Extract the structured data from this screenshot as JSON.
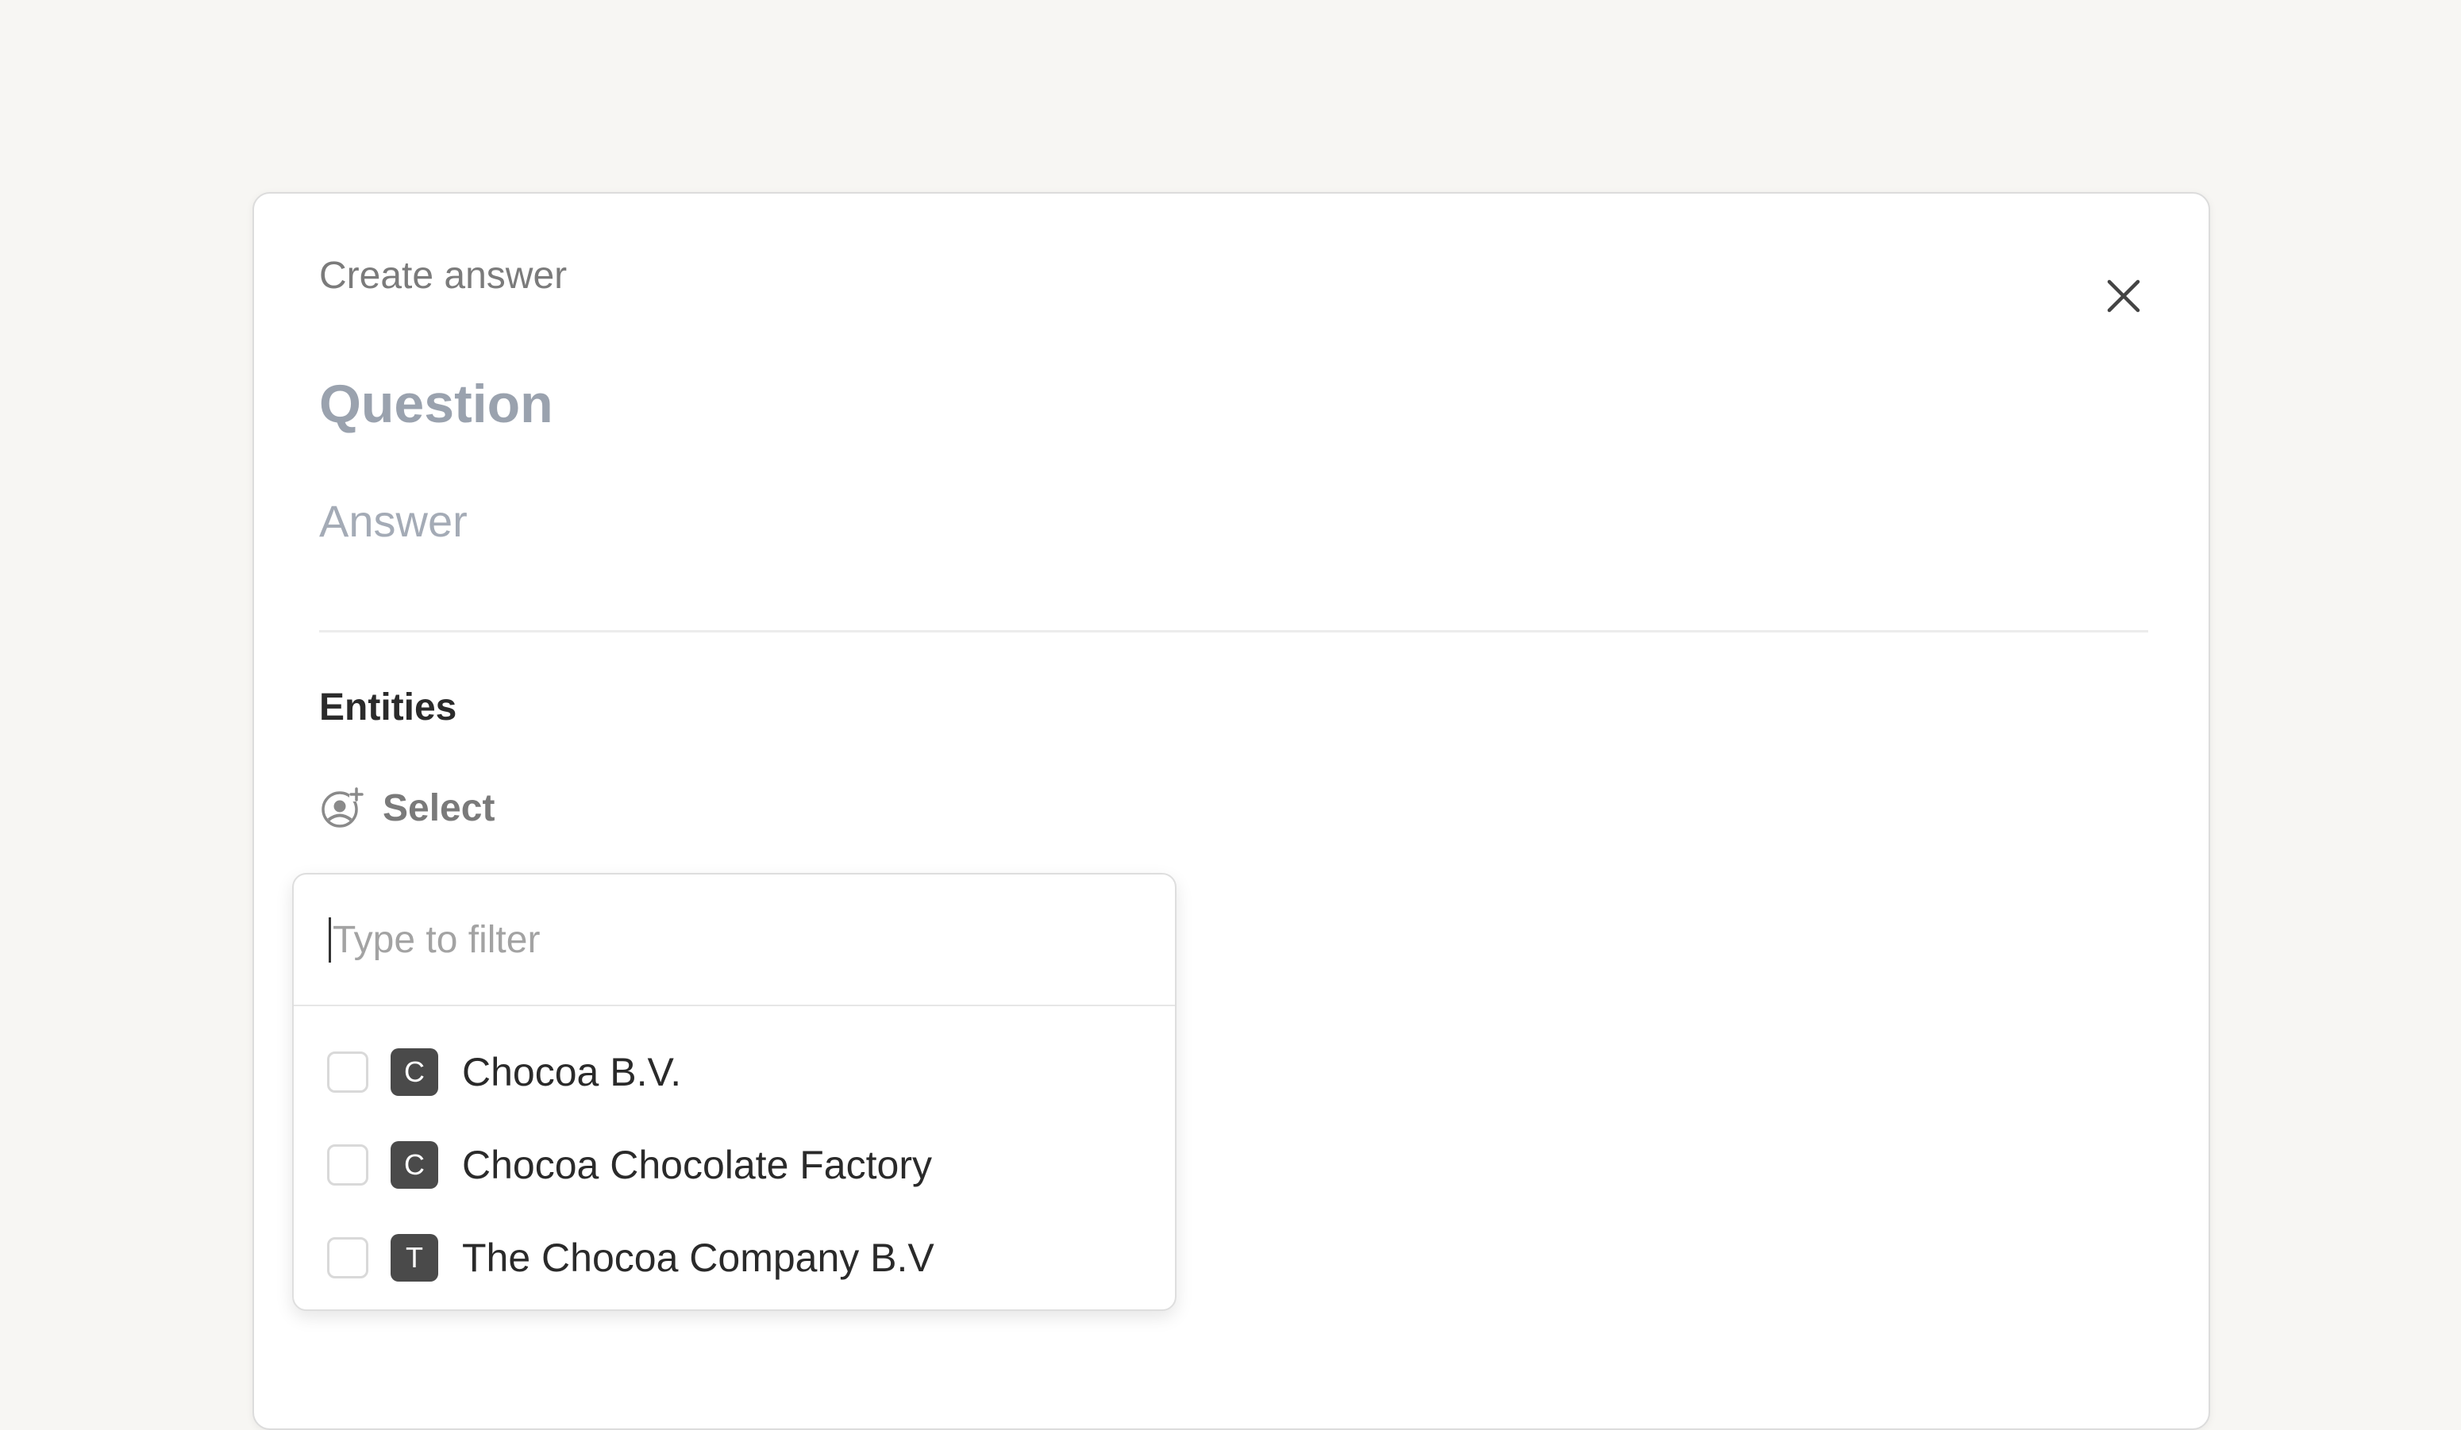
{
  "modal": {
    "title": "Create answer",
    "question_placeholder": "Question",
    "answer_placeholder": "Answer",
    "entities_label": "Entities",
    "select_label": "Select",
    "close_icon": "close-icon",
    "select_icon": "user-add-icon"
  },
  "dropdown": {
    "filter_placeholder": "Type to filter",
    "filter_value": "",
    "options": [
      {
        "initial": "C",
        "label": "Chocoa B.V."
      },
      {
        "initial": "C",
        "label": "Chocoa Chocolate Factory"
      },
      {
        "initial": "T",
        "label": "The Chocoa Company B.V"
      }
    ]
  },
  "colors": {
    "background": "#f7f6f3",
    "avatar": "#4a4a4a"
  }
}
